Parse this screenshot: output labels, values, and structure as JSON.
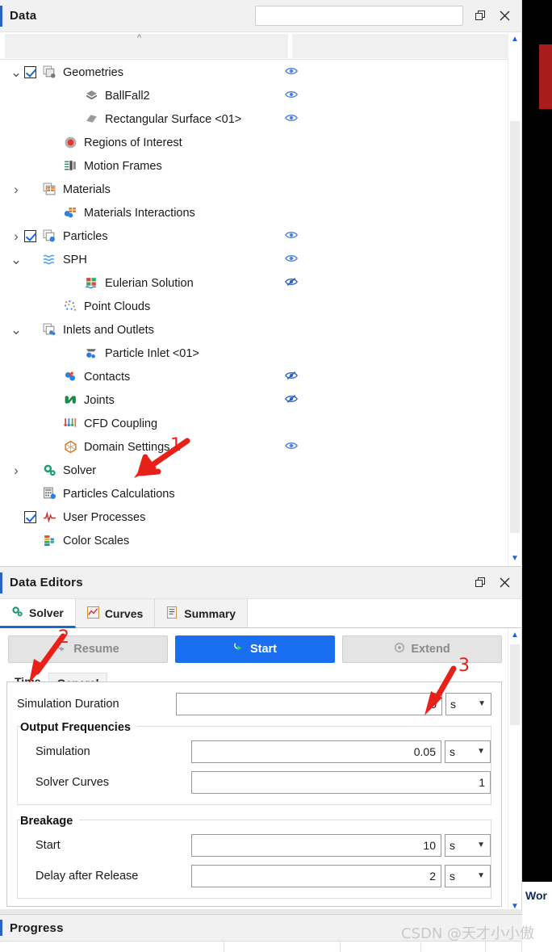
{
  "data_panel": {
    "title": "Data",
    "search_value": "",
    "search_placeholder": "",
    "restore_icon": "restore-window-icon",
    "close_icon": "close-icon",
    "column_headers": [
      "",
      ""
    ],
    "tree": [
      {
        "label": "Geometries",
        "indent": 0,
        "twist": "v",
        "check": "on",
        "icon": "geometries-icon",
        "eye": "visible"
      },
      {
        "label": "BallFall2",
        "indent": 2,
        "twist": "",
        "check": "none",
        "icon": "solid-body-icon",
        "eye": "visible"
      },
      {
        "label": "Rectangular Surface <01>",
        "indent": 2,
        "twist": "",
        "check": "none",
        "icon": "surface-icon",
        "eye": "visible"
      },
      {
        "label": "Regions of Interest",
        "indent": 1,
        "twist": "",
        "check": "none",
        "icon": "regions-of-interest-icon",
        "eye": ""
      },
      {
        "label": "Motion Frames",
        "indent": 1,
        "twist": "",
        "check": "none",
        "icon": "motion-frames-icon",
        "eye": ""
      },
      {
        "label": "Materials",
        "indent": 0,
        "twist": ">",
        "check": "none",
        "icon": "materials-icon",
        "eye": ""
      },
      {
        "label": "Materials Interactions",
        "indent": 1,
        "twist": "",
        "check": "none",
        "icon": "materials-interactions-icon",
        "eye": ""
      },
      {
        "label": "Particles",
        "indent": 0,
        "twist": ">",
        "check": "on",
        "icon": "particles-icon",
        "eye": "visible"
      },
      {
        "label": "SPH",
        "indent": 0,
        "twist": "v",
        "check": "none",
        "icon": "sph-icon",
        "eye": "visible"
      },
      {
        "label": "Eulerian Solution",
        "indent": 2,
        "twist": "",
        "check": "none",
        "icon": "eulerian-solution-icon",
        "eye": "hidden"
      },
      {
        "label": "Point Clouds",
        "indent": 1,
        "twist": "",
        "check": "none",
        "icon": "point-clouds-icon",
        "eye": ""
      },
      {
        "label": "Inlets and Outlets",
        "indent": 0,
        "twist": "v",
        "check": "none",
        "icon": "inlets-outlets-icon",
        "eye": ""
      },
      {
        "label": "Particle Inlet <01>",
        "indent": 2,
        "twist": "",
        "check": "none",
        "icon": "particle-inlet-icon",
        "eye": ""
      },
      {
        "label": "Contacts",
        "indent": 1,
        "twist": "",
        "check": "none",
        "icon": "contacts-icon",
        "eye": "hidden"
      },
      {
        "label": "Joints",
        "indent": 1,
        "twist": "",
        "check": "none",
        "icon": "joints-icon",
        "eye": "hidden"
      },
      {
        "label": "CFD Coupling",
        "indent": 1,
        "twist": "",
        "check": "none",
        "icon": "cfd-coupling-icon",
        "eye": ""
      },
      {
        "label": "Domain Settings",
        "indent": 1,
        "twist": "",
        "check": "none",
        "icon": "domain-settings-icon",
        "eye": "visible"
      },
      {
        "label": "Solver",
        "indent": 0,
        "twist": ">",
        "check": "none",
        "icon": "solver-icon",
        "eye": ""
      },
      {
        "label": "Particles Calculations",
        "indent": 0,
        "twist": "",
        "check": "none",
        "icon": "particles-calculations-icon",
        "eye": ""
      },
      {
        "label": "User Processes",
        "indent": 0,
        "twist": "",
        "check": "on",
        "icon": "user-processes-icon",
        "eye": ""
      },
      {
        "label": "Color Scales",
        "indent": 0,
        "twist": "",
        "check": "none",
        "icon": "color-scales-icon",
        "eye": ""
      }
    ]
  },
  "editors_panel": {
    "title": "Data Editors",
    "restore_icon": "restore-window-icon",
    "close_icon": "close-icon",
    "tabs": [
      {
        "label": "Solver",
        "icon": "solver-icon",
        "active": true
      },
      {
        "label": "Curves",
        "icon": "curves-icon",
        "active": false
      },
      {
        "label": "Summary",
        "icon": "summary-icon",
        "active": false
      }
    ],
    "buttons": [
      {
        "label": "Resume",
        "icon": "resume-icon",
        "style": "disabled"
      },
      {
        "label": "Start",
        "icon": "start-icon",
        "style": "primary"
      },
      {
        "label": "Extend",
        "icon": "extend-icon",
        "style": "disabled"
      }
    ],
    "subtabs": [
      {
        "label": "Time",
        "active": true
      },
      {
        "label": "General",
        "active": false
      }
    ],
    "form": {
      "simulation_duration": {
        "label": "Simulation Duration",
        "value": "5",
        "unit": "s"
      },
      "output_frequencies": {
        "title": "Output Frequencies",
        "simulation": {
          "label": "Simulation",
          "value": "0.05",
          "unit": "s"
        },
        "solver_curves": {
          "label": "Solver Curves",
          "value": "1",
          "unit": ""
        }
      },
      "breakage": {
        "title": "Breakage",
        "start": {
          "label": "Start",
          "value": "10",
          "unit": "s"
        },
        "delay_after_release": {
          "label": "Delay after Release",
          "value": "2",
          "unit": "s"
        }
      }
    }
  },
  "progress_panel": {
    "title": "Progress"
  },
  "viewport": {
    "bottom_label": "Wor"
  },
  "watermark": "CSDN @天才小小傲",
  "annotations": [
    {
      "number": "1",
      "target": "solver-tree-item"
    },
    {
      "number": "2",
      "target": "resume-button"
    },
    {
      "number": "3",
      "target": "simulation-duration-input"
    }
  ],
  "colors": {
    "accent": "#1668d8",
    "primary_button": "#1a6ef0",
    "annotation": "#e8201a",
    "eye": "#4a7fe0"
  }
}
